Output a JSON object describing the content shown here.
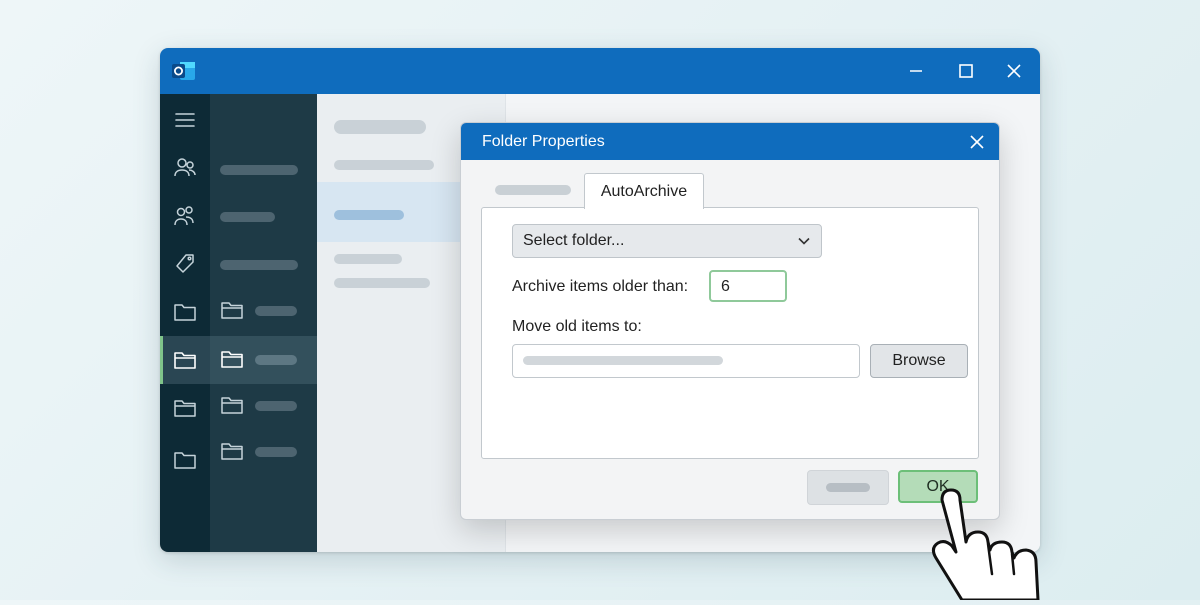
{
  "app": {
    "logo_icon": "outlook-logo-icon",
    "accent": "#0f6cbd"
  },
  "window_controls": [
    "minimize-icon",
    "maximize-icon",
    "close-icon"
  ],
  "nav_rail": {
    "icons": [
      "hamburger-menu-icon",
      "people-icon",
      "groups-icon",
      "tag-icon",
      "folder-icon",
      "folder-icon",
      "folder-icon",
      "folder-icon"
    ],
    "active_index": 5
  },
  "dialog": {
    "title": "Folder Properties",
    "tabs": [
      {
        "label": ""
      },
      {
        "label": "AutoArchive",
        "active": true
      }
    ],
    "folder_select": {
      "value": "Select folder..."
    },
    "archive_label": "Archive items older than:",
    "archive_value": "6",
    "move_label": "Move old items to:",
    "browse_label": "Browse",
    "ok_label": "OK",
    "ok_color": "#b4dcb8"
  },
  "pointer": {
    "icon": "hand-pointer-icon"
  }
}
